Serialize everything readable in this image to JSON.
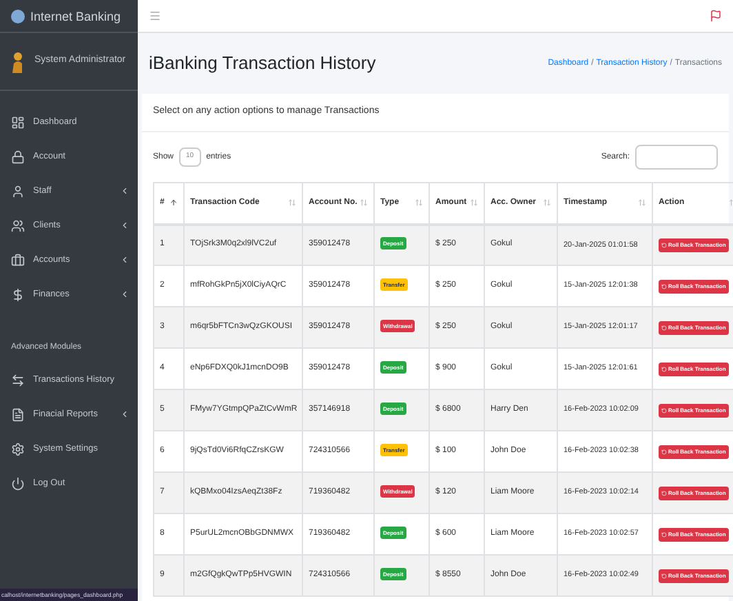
{
  "sidebar": {
    "brand": "Internet Banking",
    "user": "System Administrator",
    "items": [
      {
        "label": "Dashboard",
        "submenu": false
      },
      {
        "label": "Account",
        "submenu": false
      },
      {
        "label": "Staff",
        "submenu": true
      },
      {
        "label": "Clients",
        "submenu": true
      },
      {
        "label": "Accounts",
        "submenu": true
      },
      {
        "label": "Finances",
        "submenu": true
      }
    ],
    "section": "Advanced Modules",
    "advanced_items": [
      {
        "label": "Transactions History",
        "submenu": false
      },
      {
        "label": "Finacial Reports",
        "submenu": true
      },
      {
        "label": "System Settings",
        "submenu": false
      },
      {
        "label": "Log Out",
        "submenu": false
      }
    ]
  },
  "status_bar": "calhost/internetbanking/pages_dashboard.php",
  "page_title": "iBanking Transaction History",
  "breadcrumb": [
    {
      "label": "Dashboard",
      "link": true
    },
    {
      "label": "/",
      "link": false
    },
    {
      "label": "Transaction History",
      "link": true
    },
    {
      "label": "/",
      "link": false
    },
    {
      "label": "Transactions",
      "link": false
    }
  ],
  "card_title": "Select on any action options to manage Transactions",
  "show": "Show",
  "page_size": "10",
  "entries": "entries",
  "search_label": "Search:",
  "table": {
    "columns": [
      "#",
      "Transaction Code",
      "Account No.",
      "Type",
      "Amount",
      "Acc. Owner",
      "Timestamp",
      "Action"
    ],
    "rows": [
      {
        "n": "1",
        "code": "TOjSrk3M0q2xl9lVC2uf",
        "account": "359012478",
        "type": "Deposit",
        "kind": "deposit",
        "amount": "$ 250",
        "owner": "Gokul",
        "timestamp": "20-Jan-2025 01:01:58",
        "action": "Roll Back Transaction"
      },
      {
        "n": "2",
        "code": "mfRohGkPn5jX0lCiyAQrC",
        "account": "359012478",
        "type": "Transfer",
        "kind": "transfer",
        "amount": "$ 250",
        "owner": "Gokul",
        "timestamp": "15-Jan-2025 12:01:38",
        "action": "Roll Back Transaction"
      },
      {
        "n": "3",
        "code": "m6qr5bFTCn3wQzGKOUSI",
        "account": "359012478",
        "type": "Withdrawal",
        "kind": "withdrawal",
        "amount": "$ 250",
        "owner": "Gokul",
        "timestamp": "15-Jan-2025 12:01:17",
        "action": "Roll Back Transaction"
      },
      {
        "n": "4",
        "code": "eNp6FDXQ0kJ1mcnDO9B",
        "account": "359012478",
        "type": "Deposit",
        "kind": "deposit",
        "amount": "$ 900",
        "owner": "Gokul",
        "timestamp": "15-Jan-2025 12:01:61",
        "action": "Roll Back Transaction"
      },
      {
        "n": "5",
        "code": "FMyw7YGtmpQPaZtCvWmR",
        "account": "357146918",
        "type": "Deposit",
        "kind": "deposit",
        "amount": "$ 6800",
        "owner": "Harry Den",
        "timestamp": "16-Feb-2023 10:02:09",
        "action": "Roll Back Transaction"
      },
      {
        "n": "6",
        "code": "9jQsTd0Vi6RfqCZrsKGW",
        "account": "724310566",
        "type": "Transfer",
        "kind": "transfer",
        "amount": "$ 100",
        "owner": "John Doe",
        "timestamp": "16-Feb-2023 10:02:38",
        "action": "Roll Back Transaction"
      },
      {
        "n": "7",
        "code": "kQBMxo04IzsAeqZt38Fz",
        "account": "719360482",
        "type": "Withdrawal",
        "kind": "withdrawal",
        "amount": "$ 120",
        "owner": "Liam Moore",
        "timestamp": "16-Feb-2023 10:02:14",
        "action": "Roll Back Transaction"
      },
      {
        "n": "8",
        "code": "P5urUL2mcnOBbGDNMWX",
        "account": "719360482",
        "type": "Deposit",
        "kind": "deposit",
        "amount": "$ 600",
        "owner": "Liam Moore",
        "timestamp": "16-Feb-2023 10:02:57",
        "action": "Roll Back Transaction"
      },
      {
        "n": "9",
        "code": "m2GfQgkQwTPp5HVGWIN",
        "account": "724310566",
        "type": "Deposit",
        "kind": "deposit",
        "amount": "$ 8550",
        "owner": "John Doe",
        "timestamp": "16-Feb-2023 10:02:49",
        "action": "Roll Back Transaction"
      }
    ]
  }
}
